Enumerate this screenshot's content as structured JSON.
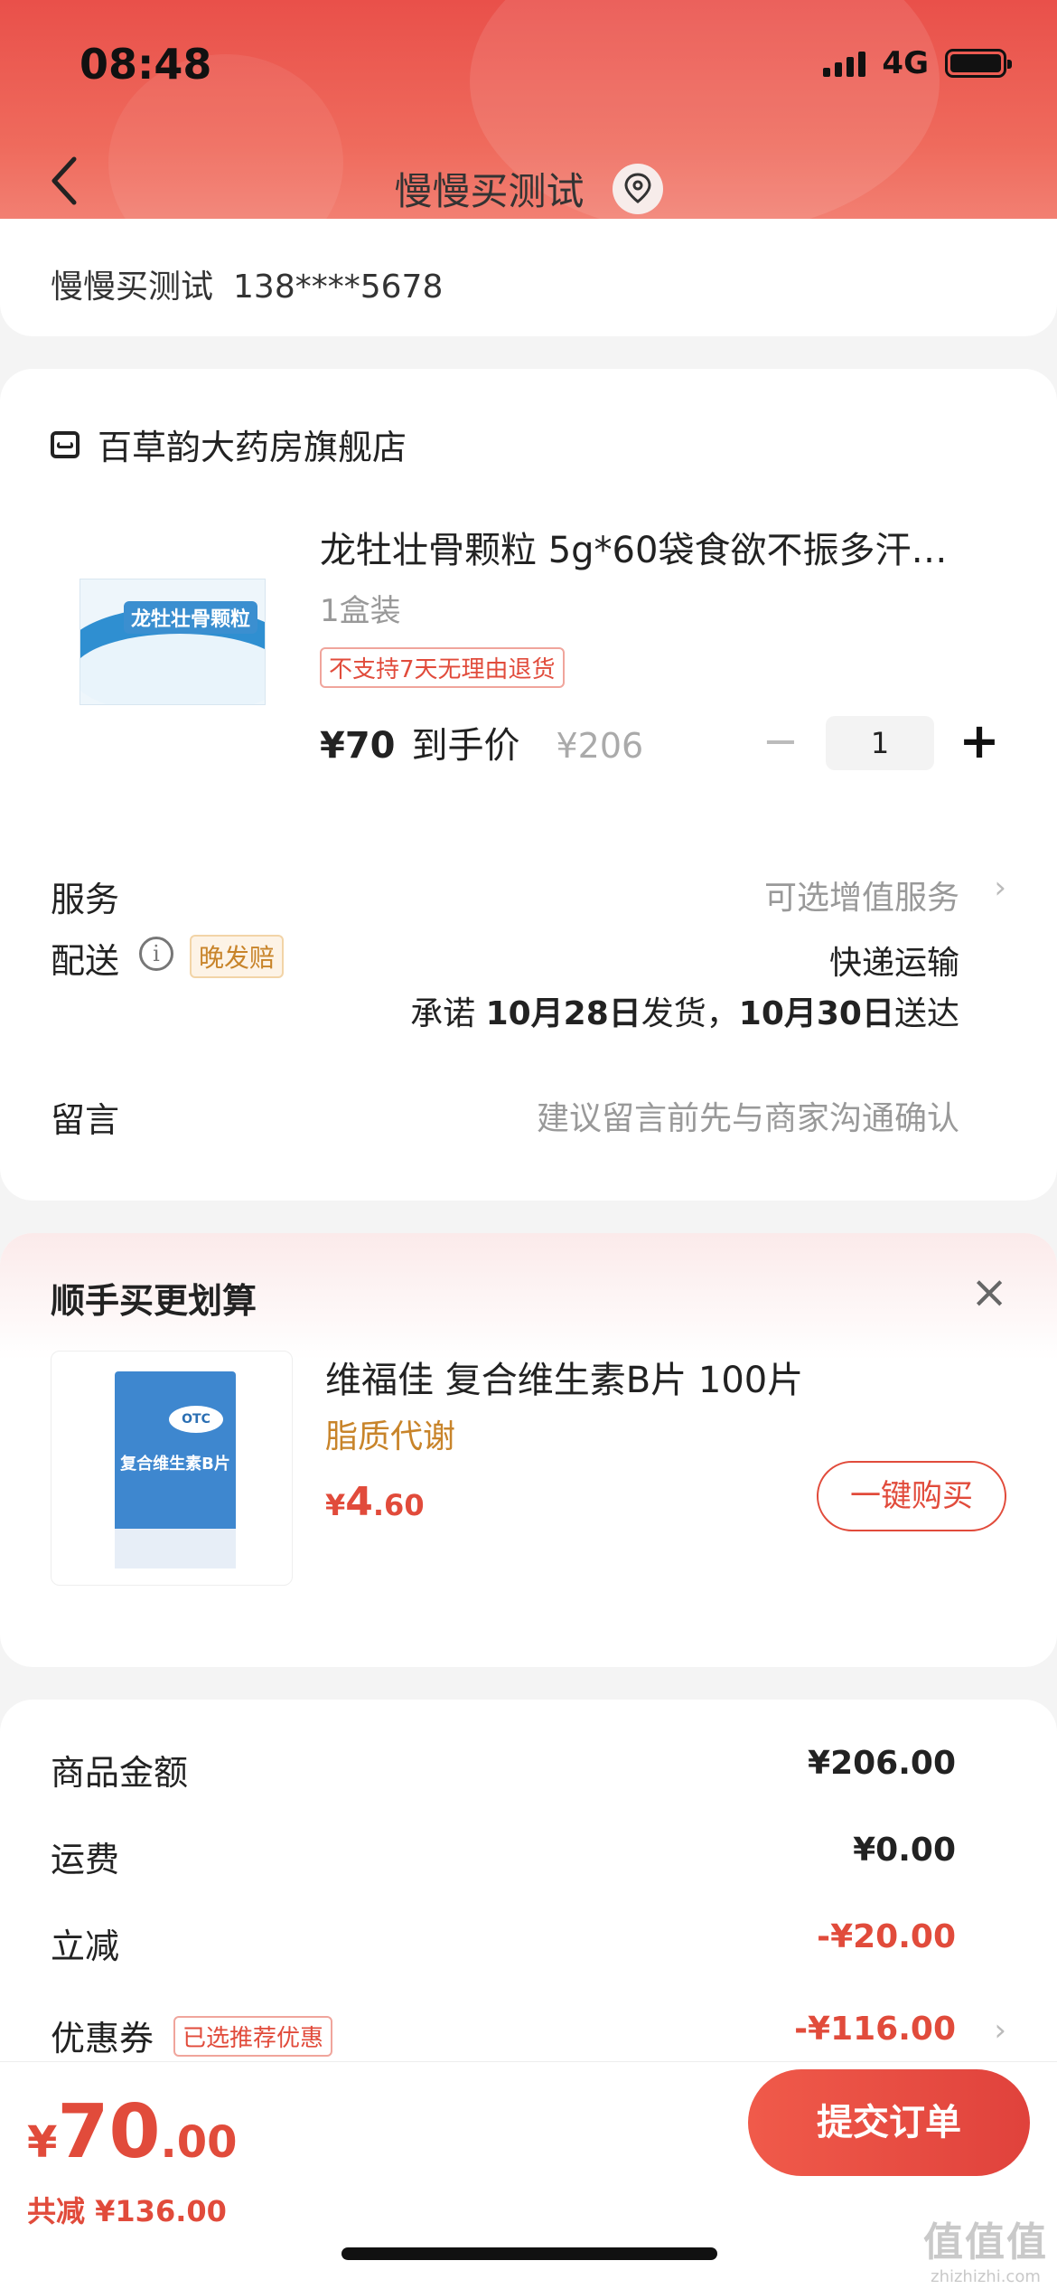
{
  "status_bar": {
    "time": "08:48",
    "network": "4G"
  },
  "header": {
    "title": "慢慢买测试"
  },
  "address": {
    "name": "慢慢买测试",
    "phone": "138****5678"
  },
  "shop": {
    "name": "百草韵大药房旗舰店"
  },
  "product": {
    "title": "龙牡壮骨颗粒 5g*60袋食欲不振多汗…",
    "image_label": "龙牡壮骨颗粒",
    "spec": "1盒装",
    "tag": "不支持7天无理由退货",
    "price": "¥70",
    "price_label": "到手价",
    "original_price": "¥206",
    "quantity": "1",
    "minus_symbol": "−",
    "plus_symbol": "+"
  },
  "service": {
    "label": "服务",
    "value": "可选增值服务",
    "chevron": "›"
  },
  "delivery": {
    "label": "配送",
    "info_symbol": "i",
    "badge": "晚发赔",
    "method": "快递运输",
    "promise_prefix": "承诺",
    "ship_date": "10月28日",
    "ship_text": "发货，",
    "arrive_date": "10月30日",
    "arrive_text": "送达"
  },
  "message": {
    "label": "留言",
    "placeholder": "建议留言前先与商家沟通确认"
  },
  "recommend": {
    "title": "顺手买更划算",
    "close_symbol": "×",
    "product_name": "维福佳 复合维生素B片 100片",
    "image_label": "复合维生素B片",
    "image_otc": "OTC",
    "tag": "脂质代谢",
    "price_currency": "¥",
    "price_int": "4",
    "price_dec": ".60",
    "buy_label": "一键购买"
  },
  "summary": {
    "goods_label": "商品金额",
    "goods_value": "¥206.00",
    "shipping_label": "运费",
    "shipping_value": "¥0.00",
    "discount_label": "立减",
    "discount_value": "-¥20.00",
    "coupon_label": "优惠券",
    "coupon_badge": "已选推荐优惠",
    "coupon_value": "-¥116.00",
    "chevron": "›"
  },
  "bottom": {
    "currency": "¥",
    "total_int": "70",
    "total_dec": ".00",
    "saved": "共减 ¥136.00",
    "submit_label": "提交订单"
  },
  "watermark": {
    "main": "值值值",
    "sub": "zhizhizhi.com"
  },
  "colors": {
    "accent": "#e14b3b",
    "header": "#ef6b5d",
    "tag_orange": "#c8842a"
  }
}
